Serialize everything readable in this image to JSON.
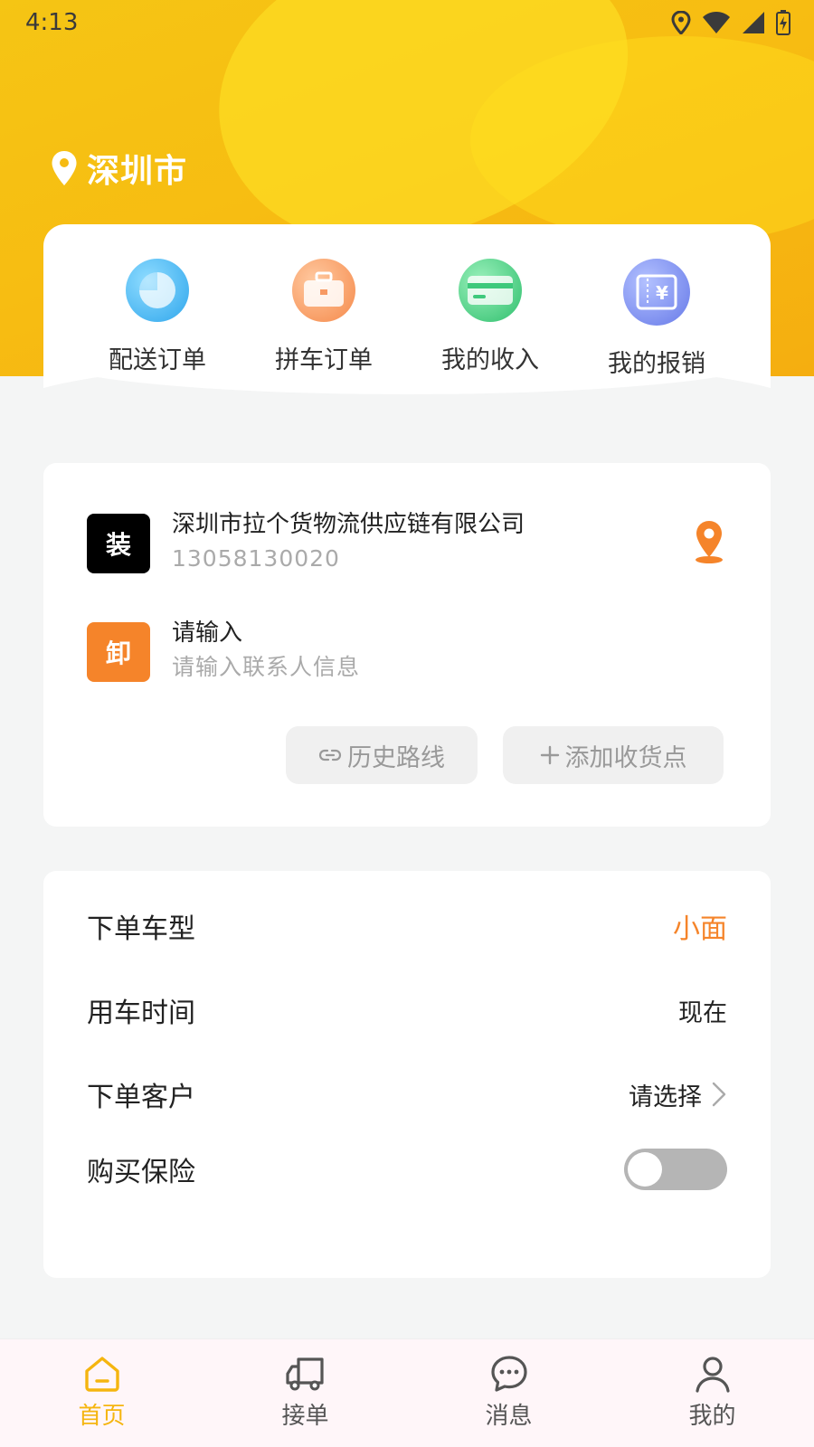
{
  "status_bar": {
    "time": "4:13"
  },
  "location": {
    "city": "深圳市"
  },
  "quick_actions": [
    {
      "label": "配送订单",
      "icon": "pie-chart-icon",
      "color": "#3fb6f0"
    },
    {
      "label": "拼车订单",
      "icon": "briefcase-icon",
      "color": "#f79a63"
    },
    {
      "label": "我的收入",
      "icon": "card-icon",
      "color": "#3ec97c"
    },
    {
      "label": "我的报销",
      "icon": "yuan-ticket-icon",
      "color": "#6f86ec"
    }
  ],
  "route": {
    "pickup": {
      "badge": "装",
      "title": "深圳市拉个货物流供应链有限公司",
      "phone": "13058130020"
    },
    "dropoff": {
      "badge": "卸",
      "title": "请输入",
      "subtitle": "请输入联系人信息"
    },
    "history_button": "历史路线",
    "add_point_button": "添加收货点"
  },
  "order_form": {
    "vehicle_type": {
      "label": "下单车型",
      "value": "小面"
    },
    "use_time": {
      "label": "用车时间",
      "value": "现在"
    },
    "customer": {
      "label": "下单客户",
      "value": "请选择"
    },
    "insurance": {
      "label": "购买保险",
      "enabled": false
    }
  },
  "tabs": [
    {
      "label": "首页",
      "icon": "home-icon",
      "active": true
    },
    {
      "label": "接单",
      "icon": "truck-icon",
      "active": false
    },
    {
      "label": "消息",
      "icon": "chat-icon",
      "active": false
    },
    {
      "label": "我的",
      "icon": "user-icon",
      "active": false
    }
  ],
  "colors": {
    "brand_yellow": "#f5b50f",
    "accent_orange": "#f5842a",
    "pickup_badge": "#000000",
    "dropoff_badge": "#f5842a"
  }
}
